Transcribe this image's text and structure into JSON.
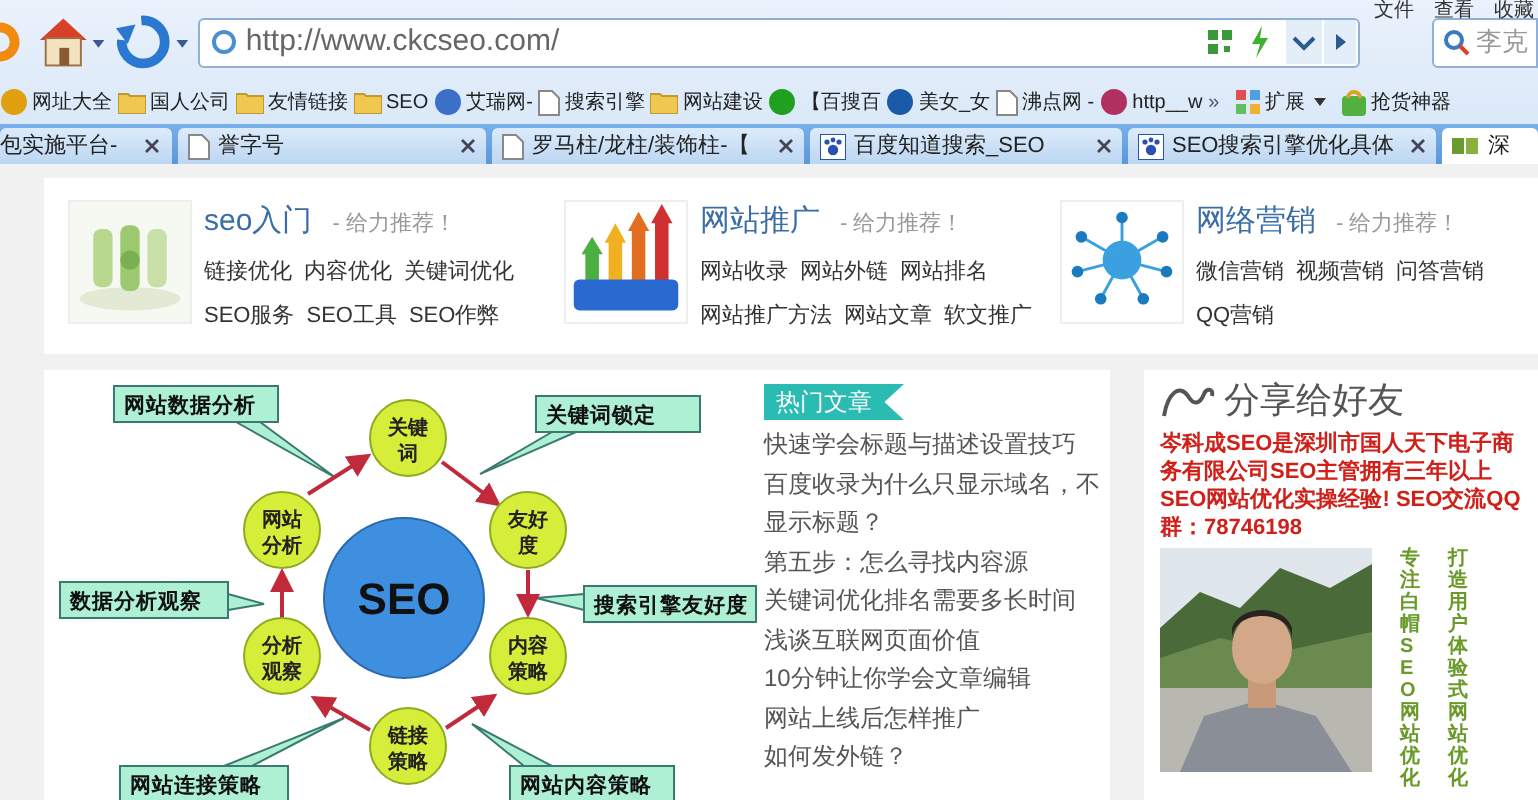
{
  "menu_bar": [
    "文件",
    "查看",
    "收藏"
  ],
  "address_bar": {
    "url": "http://www.ckcseo.com/"
  },
  "search": {
    "placeholder": "李克"
  },
  "bookmarks": [
    {
      "label": "网址大全",
      "kind": "site",
      "color": "#e0a010"
    },
    {
      "label": "国人公司",
      "kind": "folder"
    },
    {
      "label": "友情链接",
      "kind": "folder"
    },
    {
      "label": "SEO",
      "kind": "folder"
    },
    {
      "label": "艾瑞网-",
      "kind": "site",
      "color": "#3a70c8"
    },
    {
      "label": "搜索引擎",
      "kind": "page"
    },
    {
      "label": "网站建设",
      "kind": "folder"
    },
    {
      "label": "【百搜百",
      "kind": "site",
      "color": "#20a020"
    },
    {
      "label": "美女_女",
      "kind": "site",
      "color": "#1a5aa8"
    },
    {
      "label": "沸点网 -",
      "kind": "page"
    },
    {
      "label": "http__w",
      "kind": "site",
      "color": "#b03060"
    }
  ],
  "bookmarks_more": "»",
  "extensions": [
    {
      "label": "扩展",
      "kind": "grid"
    },
    {
      "label": "抢货神器",
      "kind": "bag"
    }
  ],
  "tabs": [
    {
      "label": "包实施平台-",
      "kind": "none",
      "selected": false
    },
    {
      "label": "誉字号",
      "kind": "page",
      "selected": false
    },
    {
      "label": "罗马柱/龙柱/装饰柱-【",
      "kind": "page",
      "selected": false
    },
    {
      "label": "百度知道搜索_SEO",
      "kind": "paw",
      "selected": false
    },
    {
      "label": "SEO搜索引擎优化具体",
      "kind": "paw",
      "selected": false
    },
    {
      "label": "深",
      "kind": "logo",
      "selected": true
    }
  ],
  "categories": [
    {
      "title": "seo入门",
      "tagline": "- 给力推荐！",
      "links": [
        "链接优化",
        "内容优化",
        "关键词优化",
        "SEO服务",
        "SEO工具",
        "SEO作弊"
      ]
    },
    {
      "title": "网站推广",
      "tagline": "- 给力推荐！",
      "links": [
        "网站收录",
        "网站外链",
        "网站排名",
        "网站推广方法",
        "网站文章",
        "软文推广"
      ]
    },
    {
      "title": "网络营销",
      "tagline": "- 给力推荐！",
      "links": [
        "微信营销",
        "视频营销",
        "问答营销",
        "QQ营销"
      ]
    }
  ],
  "diagram": {
    "center": "SEO",
    "nodes": [
      "关键词",
      "友好度",
      "内容策略",
      "链接策略",
      "分析观察",
      "网站分析"
    ],
    "callouts": [
      "网站数据分析",
      "关键词锁定",
      "数据分析观察",
      "搜索引擎友好度",
      "网站连接策略",
      "网站内容策略"
    ]
  },
  "hot_articles": {
    "title": "热门文章",
    "items": [
      "快速学会标题与描述设置技巧",
      "百度收录为什么只显示域名，不显示标题？",
      "第五步：怎么寻找内容源",
      "关键词优化排名需要多长时间",
      "浅谈互联网页面价值",
      "10分钟让你学会文章编辑",
      "网站上线后怎样推广",
      "如何发外链？"
    ]
  },
  "share": {
    "title": "分享给好友",
    "intro": "岑科成SEO是深圳市国人天下电子商务有限公司SEO主管拥有三年以上SEO网站优化实操经验! SEO交流QQ群：78746198",
    "photo": {
      "kind": "picture"
    },
    "slogans": [
      "专注白帽SEO网站优化",
      "打造用户体验式网站优化"
    ]
  }
}
